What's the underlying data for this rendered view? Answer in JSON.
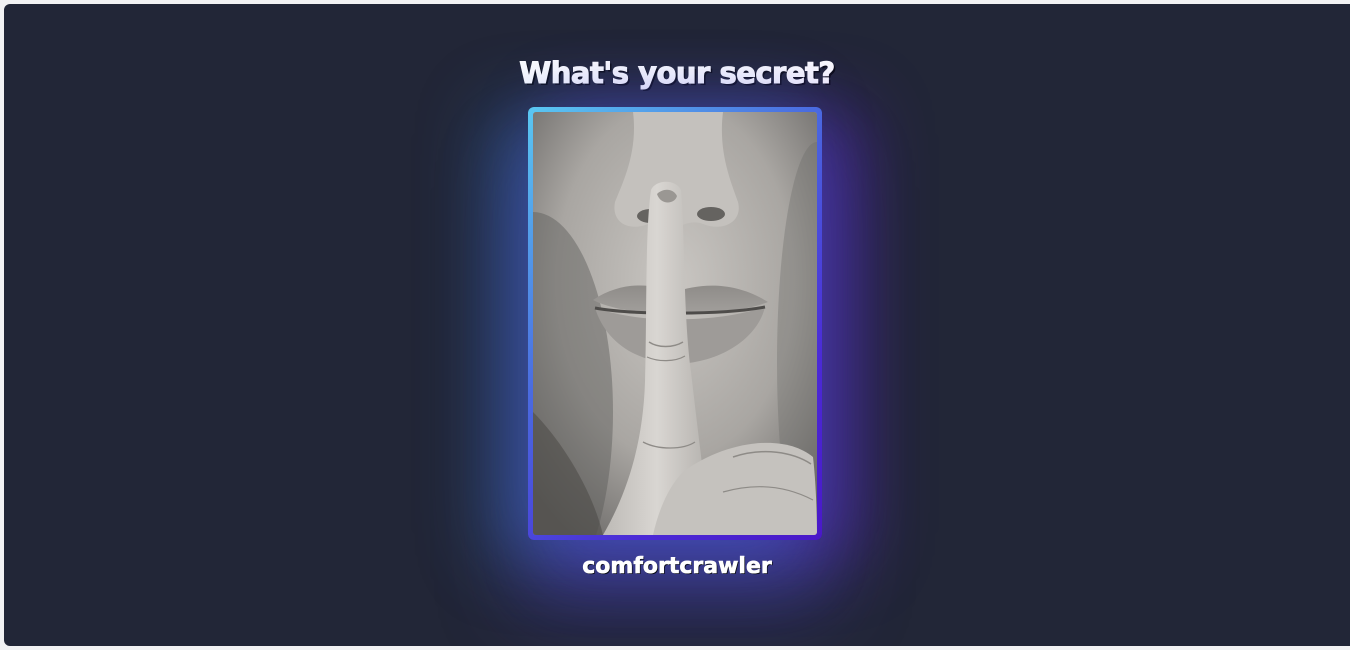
{
  "page": {
    "title": "What's your secret?",
    "username": "comfortcrawler",
    "photo_alt": "shh-finger-on-lips-photo"
  },
  "colors": {
    "background": "#222637",
    "gradient_start": "#5ac8f2",
    "gradient_end": "#4a18c8",
    "text": "#ffffff"
  }
}
